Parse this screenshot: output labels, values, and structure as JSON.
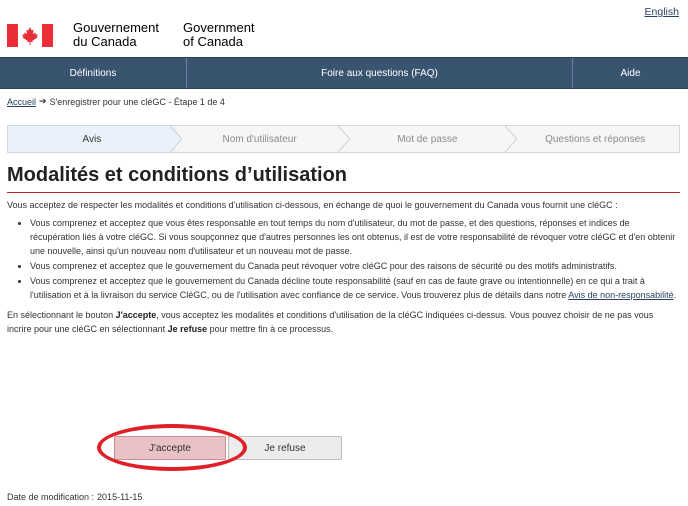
{
  "header": {
    "language_link": "English",
    "gov_fr": "Gouvernement\ndu Canada",
    "gov_en": "Government\nof Canada",
    "flag_icon": "canada-flag-icon"
  },
  "nav": {
    "items": [
      {
        "label": "Définitions"
      },
      {
        "label": "Foire aux questions (FAQ)"
      },
      {
        "label": "Aide"
      }
    ]
  },
  "breadcrumb": {
    "home": "Accueil",
    "separator": "➔",
    "current": "S'enregistrer pour une cléGC - Étape 1 de 4"
  },
  "steps": [
    {
      "label": "Avis",
      "active": true
    },
    {
      "label": "Nom d'utilisateur",
      "active": false
    },
    {
      "label": "Mot de passe",
      "active": false
    },
    {
      "label": "Questions et réponses",
      "active": false
    }
  ],
  "main": {
    "title": "Modalités et conditions d’utilisation",
    "intro": "Vous acceptez de respecter les modalités et conditions d'utilisation ci-dessous, en échange de quoi le gouvernement du Canada vous fournit une cléGC :",
    "bullets": [
      "Vous comprenez et acceptez que vous êtes responsable en tout temps du nom d'utilisateur, du mot de passe, et des questions, réponses et indices de récupération liés à votre cléGC. Si vous soupçonnez que d'autres personnes les ont obtenus, il est de votre responsabilité de révoquer votre cléGC et d'en obtenir une nouvelle, ainsi qu'un nouveau nom d'utilisateur et un nouveau mot de passe.",
      "Vous comprenez et acceptez que le gouvernement du Canada peut révoquer votre cléGC pour des raisons de sécurité ou des motifs administratifs."
    ],
    "bullet3_text": "Vous comprenez et acceptez que le gouvernement du Canada décline toute responsabilité (sauf en cas de faute grave ou intentionnelle) en ce qui a trait à l'utilisation et à la livraison du service CléGC, ou de l'utilisation avec confiance de ce service. Vous trouverez plus de détails dans notre ",
    "bullet3_link": "Avis de non-responsabilité",
    "bullet3_end": ".",
    "outro_1": "En sélectionnant le bouton ",
    "outro_accept": "J'accepte",
    "outro_2": ", vous acceptez les modalités et conditions d'utilisation de la cléGC indiquées ci-dessus. Vous pouvez choisir de ne pas vous incrire pour une cléGC en sélectionnant ",
    "outro_refuse": "Je refuse",
    "outro_3": " pour mettre fin à ce processus."
  },
  "buttons": {
    "accept": "J'accepte",
    "refuse": "Je refuse"
  },
  "footer": {
    "modified_label": "Date de modification :",
    "modified_date": "2015-11-15"
  },
  "colors": {
    "nav_bg": "#38546f",
    "accent_red": "#b8252b",
    "highlight_red": "#e02029",
    "link": "#284162"
  }
}
